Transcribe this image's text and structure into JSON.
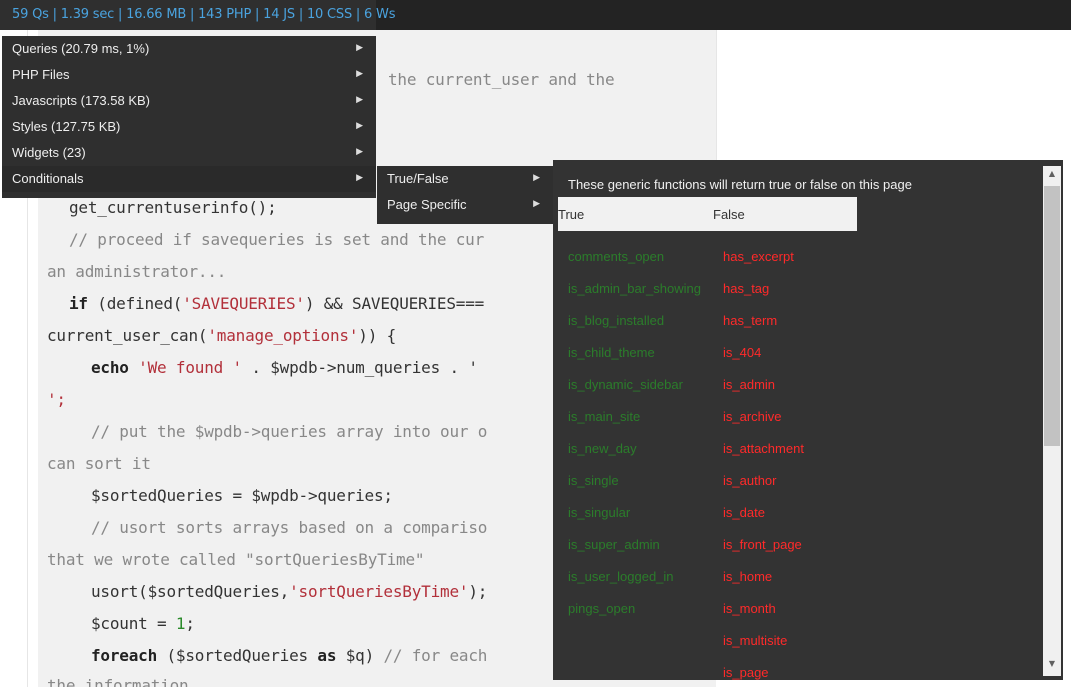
{
  "toolbar": {
    "stats": "59 Qs | 1.39 sec | 16.66 MB | 143 PHP | 14 JS | 10 CSS | 6 Ws"
  },
  "menu": {
    "items": [
      {
        "label": "Queries (20.79 ms, 1%)"
      },
      {
        "label": "PHP Files"
      },
      {
        "label": "Javascripts (173.58 KB)"
      },
      {
        "label": "Styles (127.75 KB)"
      },
      {
        "label": "Widgets (23)"
      },
      {
        "label": "Conditionals"
      }
    ],
    "arrow": "▶"
  },
  "submenu": {
    "items": [
      {
        "label": "True/False"
      },
      {
        "label": "Page Specific"
      }
    ]
  },
  "conditionals": {
    "description": "These generic functions will return true or false on this page",
    "true_header": "True",
    "false_header": "False",
    "true_items": [
      "comments_open",
      "is_admin_bar_showing",
      "is_blog_installed",
      "is_child_theme",
      "is_dynamic_sidebar",
      "is_main_site",
      "is_new_day",
      "is_single",
      "is_singular",
      "is_super_admin",
      "is_user_logged_in",
      "pings_open"
    ],
    "false_items": [
      "has_excerpt",
      "has_tag",
      "has_term",
      "is_404",
      "is_admin",
      "is_archive",
      "is_attachment",
      "is_author",
      "is_date",
      "is_front_page",
      "is_home",
      "is_month",
      "is_multisite",
      "is_page"
    ]
  },
  "scrollbar": {
    "up": "▲",
    "down": "▼"
  },
  "code": {
    "line1_frag": "the current_user and the",
    "line2": "get_currentuserinfo();",
    "line3": "// proceed if savequeries is set and the cur",
    "line4": "an administrator...",
    "line5_if": "if",
    "line5_a": " (defined(",
    "line5_str": "'SAVEQUERIES'",
    "line5_b": ") && SAVEQUERIES===",
    "line6_a": "current_user_can(",
    "line6_str": "'manage_options'",
    "line6_b": ")) {",
    "line7_echo": "echo",
    "line7_str": "'We found '",
    "line7_b": " . $wpdb->num_queries . '",
    "line8": "';",
    "line9": "// put the $wpdb->queries array into our o",
    "line10": "can sort it",
    "line11": "$sortedQueries = $wpdb->queries;",
    "line12": "// usort sorts arrays based on a compariso",
    "line13": "that we wrote called \"sortQueriesByTime\"",
    "line14_a": "usort($sortedQueries,",
    "line14_str": "'sortQueriesByTime'",
    "line14_b": ");",
    "line15_a": "$count = ",
    "line15_num": "1",
    "line15_b": ";",
    "line16_kw": "foreach",
    "line16_a": " ($sortedQueries ",
    "line16_as": "as",
    "line16_b": " $q) ",
    "line16_cm": "// for each",
    "line17": "the information"
  }
}
